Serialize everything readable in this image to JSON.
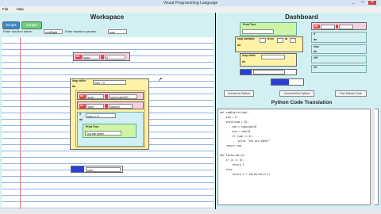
{
  "window": {
    "title": "Visual Programming Language",
    "minimize": "_",
    "maximize": "□",
    "close": "✕"
  },
  "menu": {
    "file": "File",
    "help": "Help"
  },
  "workspace": {
    "title": "Workspace",
    "tabs": [
      "Script1",
      "Script2"
    ],
    "fn_name_label": "Enter function name:",
    "fn_name_value": "sumDigits",
    "fn_params_label": "Enter function params:",
    "fn_params_value": "num",
    "int_block": {
      "type": "int",
      "name": "sum",
      "eq": "0"
    },
    "loop_block": {
      "header": "loop while",
      "cond": "num > 0",
      "do": "do",
      "line1": {
        "type": "int",
        "name": "sum",
        "expr": "sum+num%10"
      },
      "line2": {
        "type": "int",
        "name": "num",
        "expr": "num/10"
      },
      "if": {
        "kw": "if",
        "cond": "sum == 0",
        "do": "do",
        "print": "Print Text",
        "print_val": "You are done!"
      }
    },
    "return_block": {
      "value": "sum"
    }
  },
  "dashboard": {
    "title": "Dashboard",
    "print_text": "Print Text",
    "loop_var": "loop variable",
    "from": "from",
    "to": "to",
    "do": "do",
    "loop_while": "loop while",
    "int": "int",
    "if": "if",
    "else": "else",
    "elif": "elif",
    "ret": "ret",
    "btn_convert": "Convert to Python",
    "btn_convert_all": "Convert All to Python",
    "btn_run": "Run Python Code",
    "code_title": "Python Code Translation",
    "code": "def sumDigits(num):\n    sum = 0\n    while(num > 0):\n        sum = sum+num%10\n        num = num/10\n        if (sum == 0):\n            print \"You are done!\"\n    return sum\n\ndef factorial(n):\n    if (n == 0):\n        return 1\n    else:\n        return n * factorial(n-1)"
  },
  "colors": {
    "panel": "#d2f0f4",
    "accent": "#2b3fd6",
    "print": "#cef5a6",
    "loop": "#fff2a6",
    "int": "#f8cfe1",
    "ret": "#2b3fd6"
  }
}
